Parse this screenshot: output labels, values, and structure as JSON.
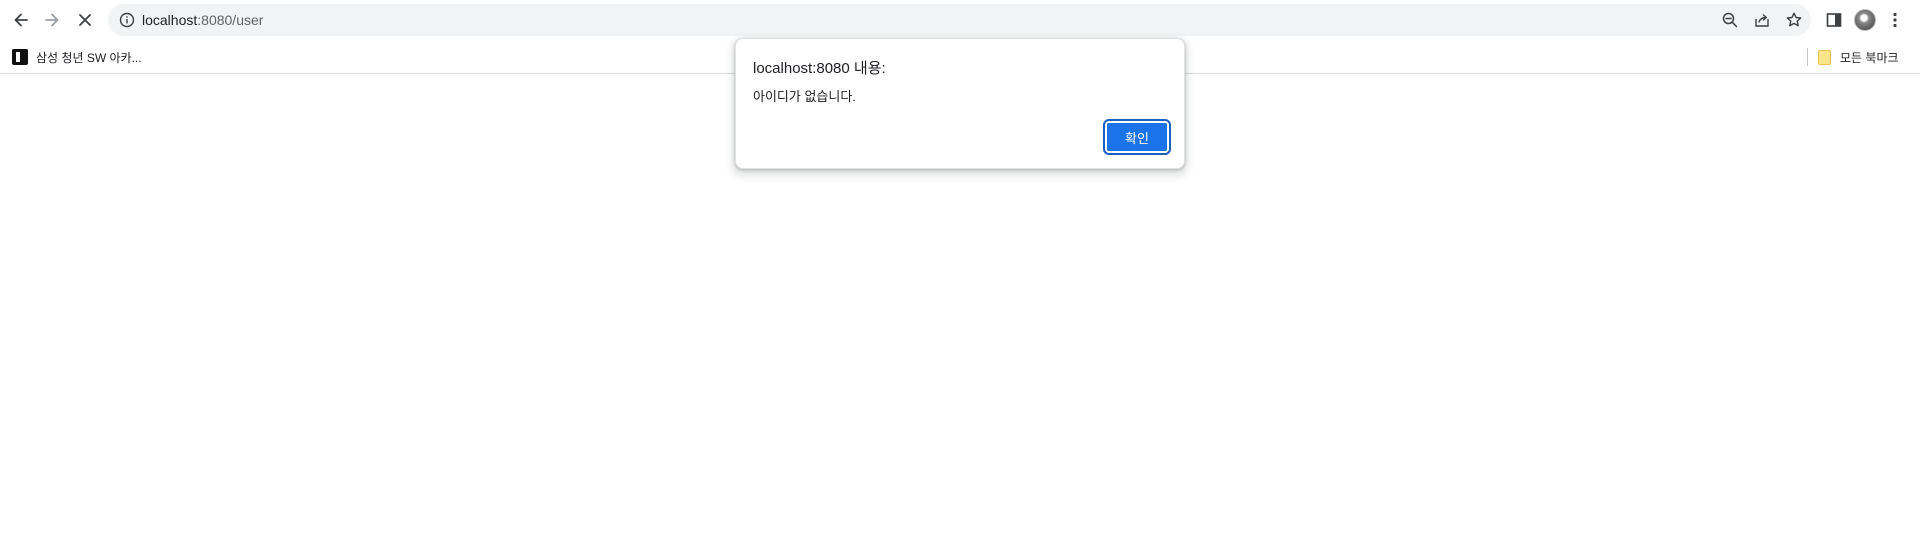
{
  "browser": {
    "url_host": "localhost",
    "url_rest": ":8080/user",
    "icons": {
      "back": "arrow-left-icon",
      "forward": "arrow-right-icon",
      "stop": "close-icon",
      "site_info": "info-icon",
      "zoom": "zoom-out-icon",
      "share": "share-icon",
      "bookmark": "star-icon",
      "side_panel": "side-panel-icon",
      "menu": "kebab-menu-icon"
    }
  },
  "bookmarks": {
    "items": [
      {
        "label": "삼성 청년 SW 아카..."
      }
    ],
    "all_bookmarks_label": "모든 북마크"
  },
  "dialog": {
    "title": "localhost:8080 내용:",
    "message": "아이디가 없습니다.",
    "ok_label": "확인",
    "accent_color": "#1a73e8"
  }
}
